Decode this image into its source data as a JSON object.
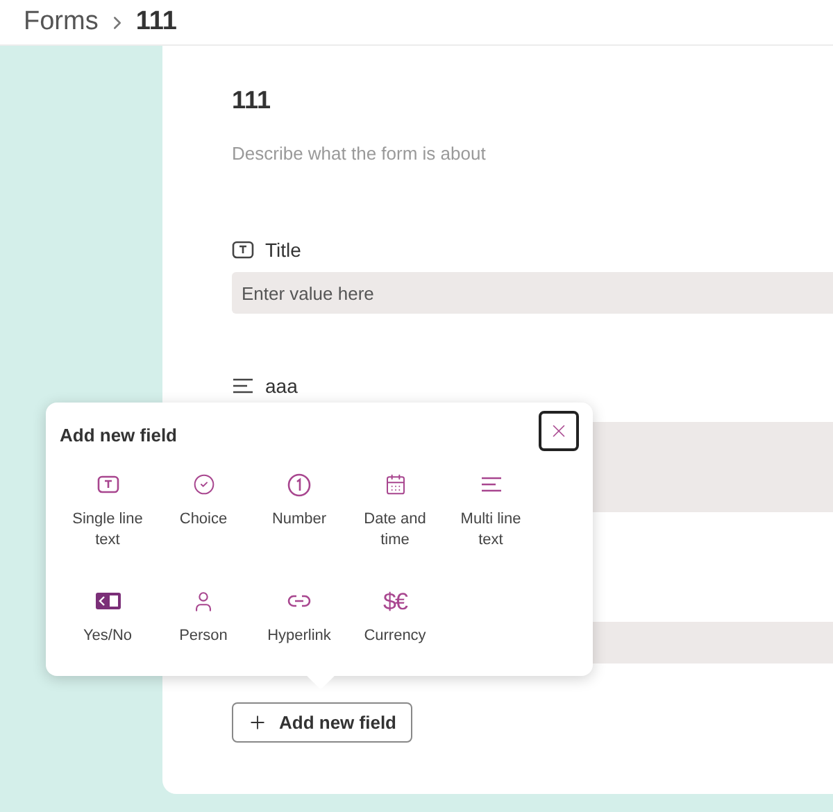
{
  "breadcrumb": [
    {
      "label": "Forms",
      "current": false
    },
    {
      "label": "111",
      "current": true
    }
  ],
  "form": {
    "title": "111",
    "description": {
      "placeholder": "Describe what the form is about"
    },
    "fields": [
      {
        "kind": "single_line",
        "label": "Title",
        "placeholder": "Enter value here"
      },
      {
        "kind": "multi_line",
        "label": "aaa"
      },
      {
        "kind": "single_line"
      }
    ],
    "add_button": "Add new field"
  },
  "popup": {
    "title": "Add new field",
    "options": [
      {
        "kind": "single_line",
        "label": "Single line text"
      },
      {
        "kind": "choice",
        "label": "Choice"
      },
      {
        "kind": "number",
        "label": "Number"
      },
      {
        "kind": "date",
        "label": "Date and time"
      },
      {
        "kind": "multi_line",
        "label": "Multi line text"
      },
      {
        "kind": "yes_no",
        "label": "Yes/No"
      },
      {
        "kind": "person",
        "label": "Person"
      },
      {
        "kind": "hyperlink",
        "label": "Hyperlink"
      },
      {
        "kind": "currency",
        "label": "Currency",
        "glyph": "$€"
      }
    ]
  }
}
